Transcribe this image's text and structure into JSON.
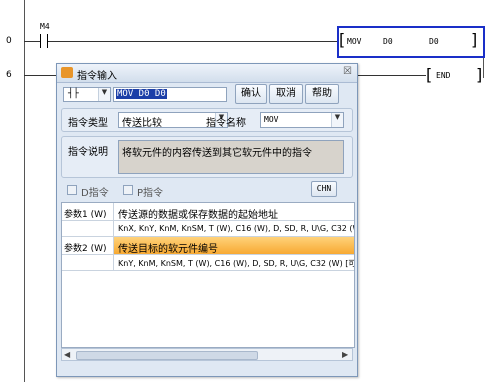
{
  "ladder": {
    "rung_numbers": [
      "0",
      "6"
    ],
    "contact_label": "M4",
    "mov": {
      "op": "MOV",
      "src": "D0",
      "dst": "D0"
    },
    "end_label": "END"
  },
  "dialog": {
    "title": "指令输入",
    "close_glyph": "☒",
    "type_selector": "┤├",
    "instruction_text": "MOV D0 D0",
    "confirm_label": "确认",
    "cancel_label": "取消",
    "help_label": "帮助",
    "type_label": "指令类型",
    "type_value": "传送比较",
    "name_label": "指令名称",
    "name_value": "MOV",
    "desc_label": "指令说明",
    "desc_value": "将软元件的内容传送到其它软元件中的指令",
    "d_check_label": "D指令",
    "p_check_label": "P指令",
    "lang_button": "CHN",
    "params": [
      {
        "name": "参数1 (W)",
        "desc": "传送源的数据或保存数据的起始地址",
        "types": "KnX, KnY, KnM, KnSM, T (W), C16 (W), D, SD, R, U\\G, C32 (W), K,"
      },
      {
        "name": "参数2 (W)",
        "desc": "传送目标的软元件编号",
        "types": "KnY, KnM, KnSM, T (W), C16 (W), D, SD, R, U\\G, C32 (W)     [可3"
      }
    ]
  }
}
